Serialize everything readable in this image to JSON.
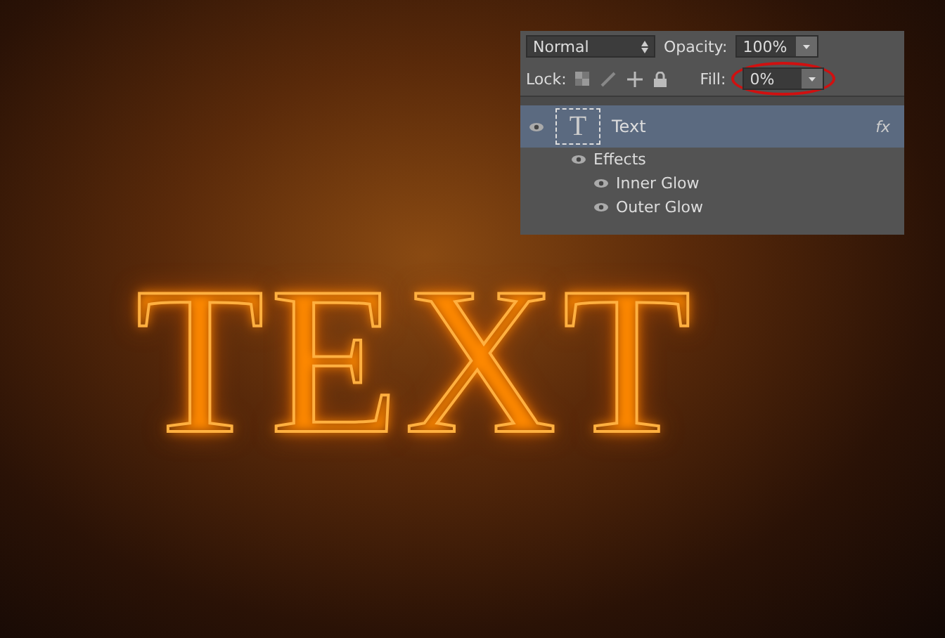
{
  "artwork": {
    "text": "TEXT"
  },
  "layers_panel": {
    "blend_mode": "Normal",
    "opacity_label": "Opacity:",
    "opacity": "100%",
    "lock_label": "Lock:",
    "fill_label": "Fill:",
    "fill": "0%",
    "fill_highlighted": true,
    "layers": [
      {
        "name": "Text",
        "thumbnail": "T",
        "fx": "fx",
        "selected": true,
        "visible": true,
        "children": [
          {
            "name": "Effects",
            "visible": true,
            "children": [
              {
                "name": "Inner Glow",
                "visible": true
              },
              {
                "name": "Outer Glow",
                "visible": true
              }
            ]
          }
        ]
      }
    ]
  }
}
